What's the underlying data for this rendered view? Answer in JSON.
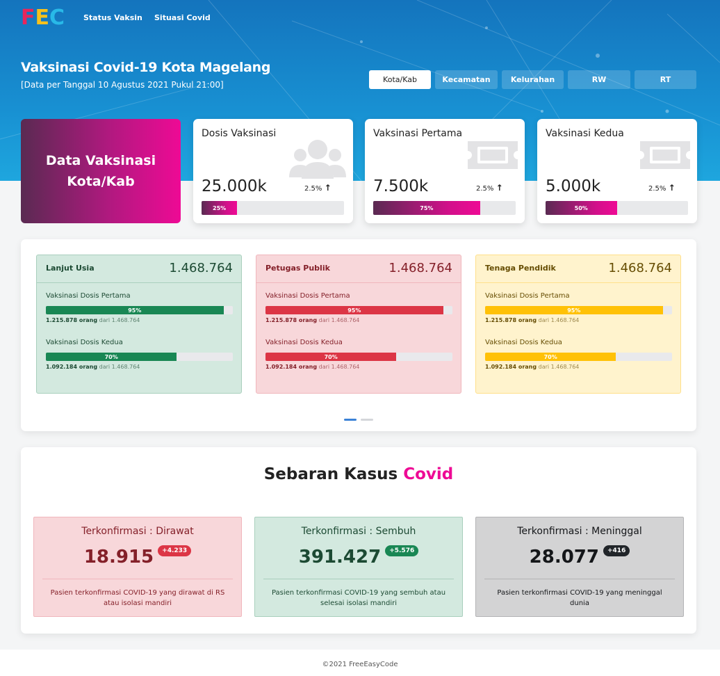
{
  "brand": {
    "logo_letters": [
      "F",
      "E",
      "C"
    ],
    "logo_colors": [
      "#e8265b",
      "#f7c11c",
      "#28b9e8"
    ]
  },
  "nav": {
    "items": [
      "Status Vaksin",
      "Situasi Covid"
    ]
  },
  "hero": {
    "title": "Vaksinasi Covid-19 Kota Magelang",
    "subtitle": "[Data per Tanggal 10 Agustus 2021 Pukul 21:00]",
    "tabs": [
      "Kota/Kab",
      "Kecamatan",
      "Kelurahan",
      "RW",
      "RT"
    ],
    "active_tab": "Kota/Kab"
  },
  "summary": {
    "heading": "Data Vaksinasi Kota/Kab",
    "cards": [
      {
        "title": "Dosis Vaksinasi",
        "value": "25.000k",
        "change": "2.5%",
        "progress_label": "25%",
        "progress": 25,
        "icon": "users-icon"
      },
      {
        "title": "Vaksinasi Pertama",
        "value": "7.500k",
        "change": "2.5%",
        "progress_label": "75%",
        "progress": 75,
        "icon": "ticket-icon"
      },
      {
        "title": "Vaksinasi Kedua",
        "value": "5.000k",
        "change": "2.5%",
        "progress_label": "50%",
        "progress": 50,
        "icon": "ticket-icon"
      }
    ]
  },
  "categories": [
    {
      "name": "Lanjut Usia",
      "total": "1.468.764",
      "dose1_label": "Vaksinasi Dosis Pertama",
      "dose1_pct_label": "95%",
      "dose1_pct": 95,
      "dose1_count": "1.215.878 orang",
      "dose1_of": "dari 1.468.764",
      "dose2_label": "Vaksinasi Dosis Kedua",
      "dose2_pct_label": "70%",
      "dose2_pct": 70,
      "dose2_count": "1.092.184 orang",
      "dose2_of": "dari 1.468.764",
      "colors": {
        "bg": "#d3e9df",
        "border": "#a9cfbd",
        "text": "#1c4a33",
        "bar": "#198754"
      }
    },
    {
      "name": "Petugas Publik",
      "total": "1.468.764",
      "dose1_label": "Vaksinasi Dosis Pertama",
      "dose1_pct_label": "95%",
      "dose1_pct": 95,
      "dose1_count": "1.215.878 orang",
      "dose1_of": "dari 1.468.764",
      "dose2_label": "Vaksinasi Dosis Kedua",
      "dose2_pct_label": "70%",
      "dose2_pct": 70,
      "dose2_count": "1.092.184 orang",
      "dose2_of": "dari 1.468.764",
      "colors": {
        "bg": "#f8d7da",
        "border": "#f0b6bc",
        "text": "#842029",
        "bar": "#dc3545"
      }
    },
    {
      "name": "Tenaga Pendidik",
      "total": "1.468.764",
      "dose1_label": "Vaksinasi Dosis Pertama",
      "dose1_pct_label": "95%",
      "dose1_pct": 95,
      "dose1_count": "1.215.878 orang",
      "dose1_of": "dari 1.468.764",
      "dose2_label": "Vaksinasi Dosis Kedua",
      "dose2_pct_label": "70%",
      "dose2_pct": 70,
      "dose2_count": "1.092.184 orang",
      "dose2_of": "dari 1.468.764",
      "colors": {
        "bg": "#fff3cd",
        "border": "#ffe08a",
        "text": "#664d03",
        "bar": "#ffc107"
      }
    }
  ],
  "carousel": {
    "active_index": 0,
    "count": 2
  },
  "cases": {
    "title_main": "Sebaran Kasus",
    "title_accent": "Covid",
    "items": [
      {
        "label": "Terkonfirmasi : Dirawat",
        "value": "18.915",
        "delta": "+4.233",
        "description": "Pasien terkonfirmasi COVID-19 yang dirawat di RS atau isolasi mandiri",
        "colors": {
          "bg": "#f8d7da",
          "border": "#f0b6bc",
          "text": "#842029",
          "badge": "#dc3545"
        }
      },
      {
        "label": "Terkonfirmasi : Sembuh",
        "value": "391.427",
        "delta": "+5.576",
        "description": "Pasien terkonfirmasi COVID-19 yang sembuh atau selesai isolasi mandiri",
        "colors": {
          "bg": "#d3e9df",
          "border": "#a9cfbd",
          "text": "#1c4a33",
          "badge": "#198754"
        }
      },
      {
        "label": "Terkonfirmasi : Meninggal",
        "value": "28.077",
        "delta": "+416",
        "description": "Pasien terkonfirmasi COVID-19 yang meninggal dunia",
        "colors": {
          "bg": "#d3d3d4",
          "border": "#b3b3b5",
          "text": "#141619",
          "badge": "#212529"
        }
      }
    ]
  },
  "footer": {
    "text": "©2021 FreeEasyCode"
  }
}
